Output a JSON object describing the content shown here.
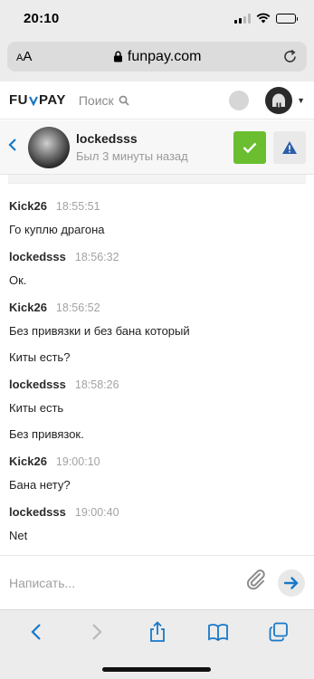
{
  "status_bar": {
    "time": "20:10"
  },
  "browser": {
    "text_size_label": "AA",
    "url": "funpay.com"
  },
  "site_header": {
    "logo_left": "FU",
    "logo_right": "PAY",
    "search_label": "Поиск"
  },
  "chat": {
    "contact_name": "lockedsss",
    "contact_status": "Был 3 минуты назад",
    "messages": [
      {
        "author": "Kick26",
        "time": "18:55:51",
        "lines": [
          "Го куплю драгона"
        ]
      },
      {
        "author": "lockedsss",
        "time": "18:56:32",
        "lines": [
          "Ок."
        ]
      },
      {
        "author": "Kick26",
        "time": "18:56:52",
        "lines": [
          "Без привязки и без бана который",
          "Киты есть?"
        ]
      },
      {
        "author": "lockedsss",
        "time": "18:58:26",
        "lines": [
          "Киты есть",
          "Без привязок."
        ]
      },
      {
        "author": "Kick26",
        "time": "19:00:10",
        "lines": [
          "Бана нету?"
        ]
      },
      {
        "author": "lockedsss",
        "time": "19:00:40",
        "lines": [
          "Net"
        ]
      }
    ]
  },
  "composer": {
    "placeholder": "Написать..."
  },
  "colors": {
    "accent": "#1878c8",
    "confirm": "#6abe2f",
    "warning": "#2b5ea8"
  },
  "icons": [
    "lock-icon",
    "reload-icon",
    "search-icon",
    "back-icon",
    "check-icon",
    "warning-icon",
    "paperclip-icon",
    "send-arrow-icon",
    "share-icon",
    "bookmarks-icon",
    "tabs-icon"
  ]
}
